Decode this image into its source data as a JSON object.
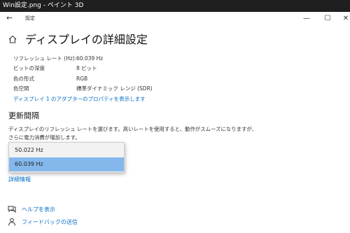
{
  "titlebar": {
    "title": "Win設定.png - ペイント 3D"
  },
  "appbar": {
    "back_glyph": "←",
    "title": "設定",
    "min_glyph": "—",
    "max_glyph": "☐",
    "close_glyph": "✕"
  },
  "page": {
    "title": "ディスプレイの詳細設定"
  },
  "display_info": {
    "cut_text": "────────────",
    "rows": [
      {
        "label": "リフレッシュ レート (Hz):",
        "value": "60.039 Hz"
      },
      {
        "label": "ビットの深度",
        "value": "8 ビット"
      },
      {
        "label": "色の形式",
        "value": "RGB"
      },
      {
        "label": "色空間",
        "value": "標準ダイナミック レンジ (SDR)"
      }
    ],
    "adapter_link": "ディスプレイ 1 のアダプターのプロパティを表示します"
  },
  "refresh": {
    "heading": "更新間隔",
    "description": "ディスプレイのリフレッシュ レートを選びます。高いレートを使用すると、動作がスムーズになりますが、さらに電力消費が増加します。",
    "options": [
      "50.022 Hz",
      "60.039 Hz"
    ],
    "selected": "60.039 Hz",
    "details_link": "詳細情報"
  },
  "footer": {
    "help": "ヘルプを表示",
    "feedback": "フィードバックの送信"
  },
  "colors": {
    "accent": "#0a6fc7",
    "selected": "#84b8ec",
    "titlebar": "#1f1f1f"
  }
}
